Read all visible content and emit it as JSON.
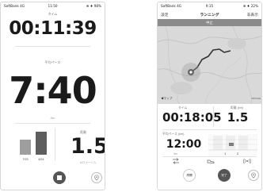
{
  "phone1": {
    "status": {
      "carrier": "SoftBank 4G",
      "time": "11:50",
      "right": "⊕ ♦ 98%"
    },
    "time_label": "タイム",
    "time_value": "00:11:39",
    "pace_label": "平均ペース",
    "pace_value": "7:40",
    "pace_unit": "/km",
    "distance_label": "距離",
    "distance_value": "1.5",
    "distance_unit": "キロメートル",
    "chart_data": {
      "type": "bar",
      "categories": [
        "7/23",
        "6/24"
      ],
      "values": [
        0.62,
        0.95
      ]
    }
  },
  "phone2": {
    "status": {
      "carrier": "SoftBank 4G",
      "time": "9:15",
      "right": "⊕ ♦ 22%"
    },
    "header": {
      "settings": "設定",
      "title": "ランニング",
      "hide": "非表示"
    },
    "banner": "中止",
    "map_label": "◀マップ",
    "map_credit": "GPS Data",
    "time_label": "タイム",
    "time_value": "00:18:05",
    "distance_label": "距離 (km)",
    "distance_value": "1.5",
    "pace_label": "平均ペース (km)",
    "pace_value": "12:00",
    "pace_unit": "/km",
    "splits": {
      "categories": [
        "1",
        "2"
      ]
    },
    "buttons": {
      "pause": "再開",
      "finish": "完了"
    }
  }
}
